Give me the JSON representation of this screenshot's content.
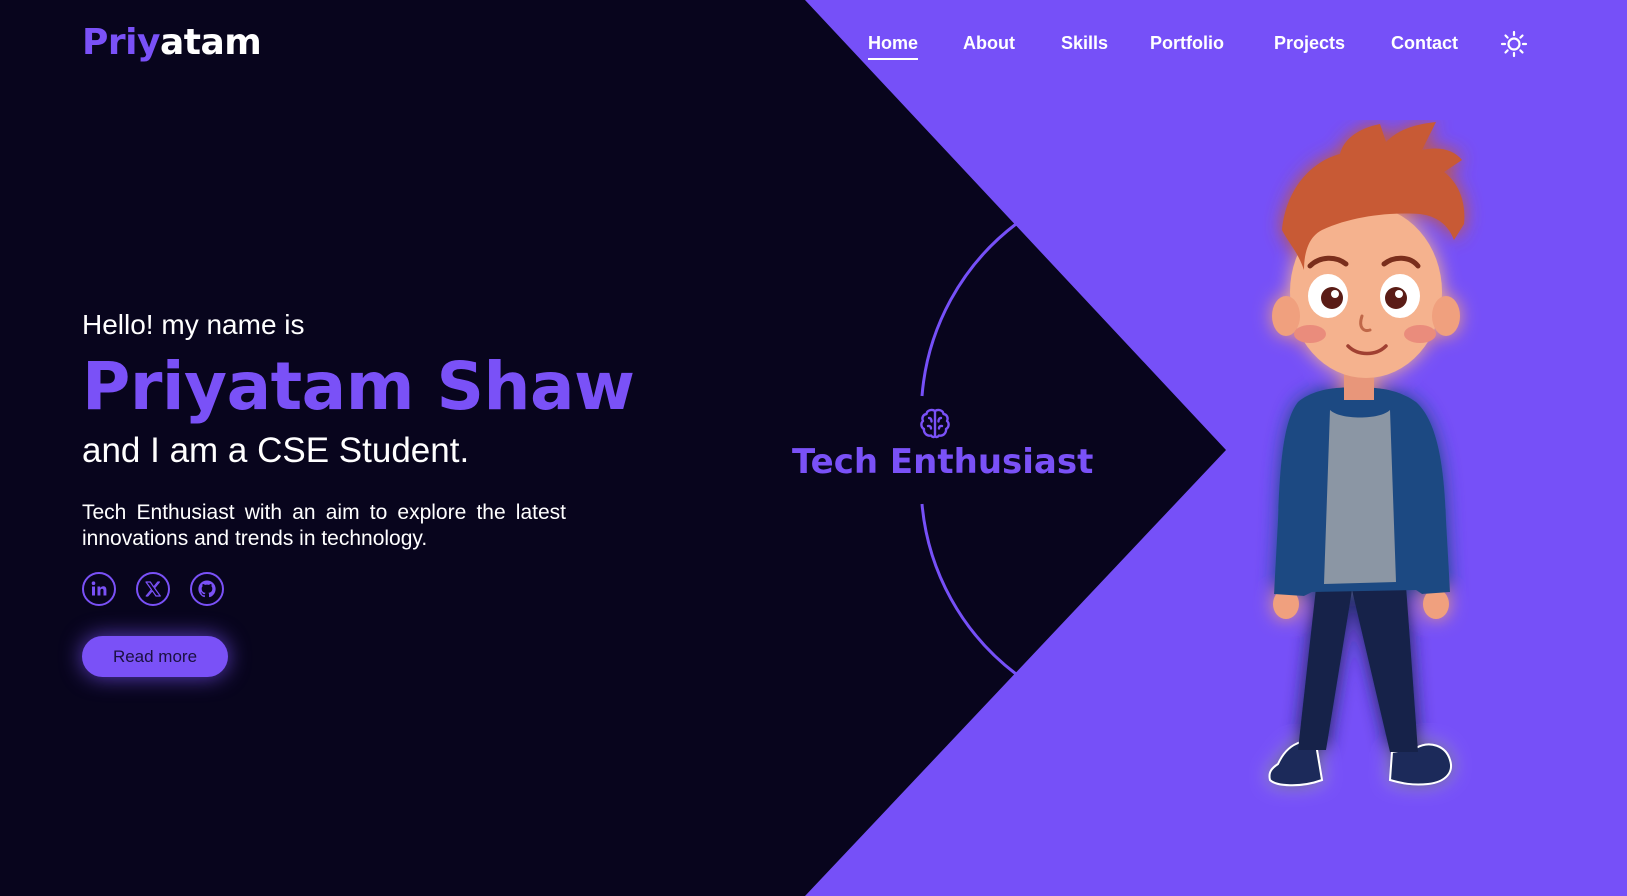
{
  "logo": {
    "accent": "Priy",
    "rest": "atam"
  },
  "nav": {
    "items": [
      "Home",
      "About",
      "Skills",
      "Portfolio",
      "Projects",
      "Contact"
    ],
    "active": "Home",
    "theme_icon": "sun-icon"
  },
  "hero": {
    "greeting": "Hello! my name is",
    "name": "Priyatam Shaw",
    "role": "and I am a CSE Student.",
    "description": "Tech Enthusiast with an aim to explore the latest innovations and trends in technology.",
    "socials": [
      "linkedin-icon",
      "x-icon",
      "github-icon"
    ],
    "cta_label": "Read more"
  },
  "badge": {
    "icon": "brain-icon",
    "label": "Tech Enthusiast"
  },
  "colors": {
    "accent": "#7a51f7",
    "background": "#08051d",
    "text": "#ffffff"
  }
}
